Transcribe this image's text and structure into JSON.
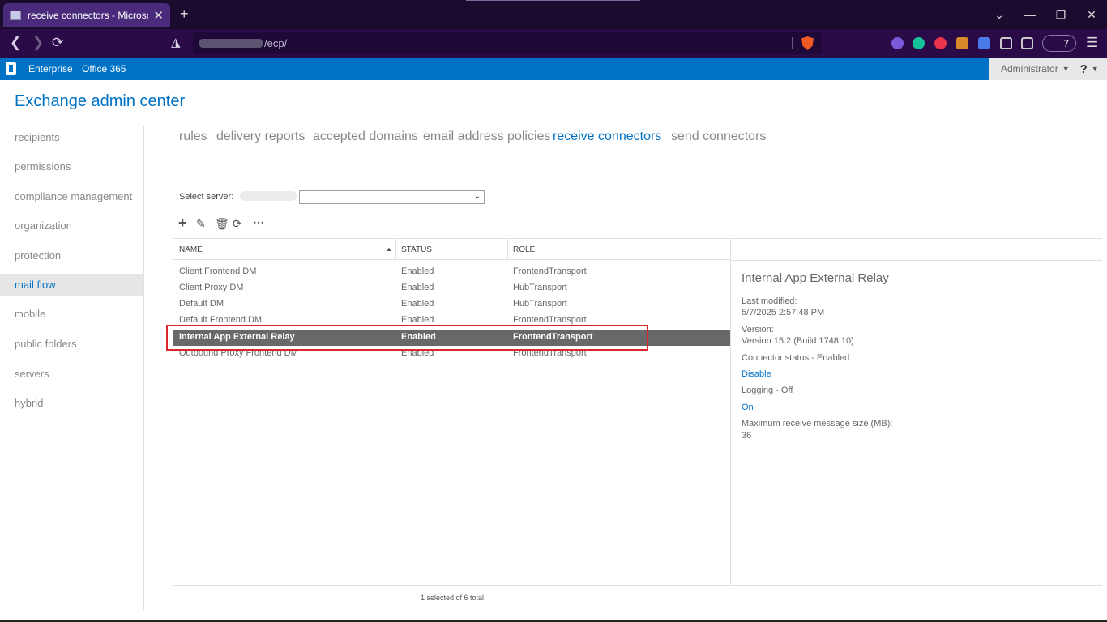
{
  "browser": {
    "tab_title": "receive connectors - Microsoft",
    "tab_close": "✕",
    "new_tab": "+",
    "url_text": "/ecp/",
    "extension_badge": "7",
    "win_minimize": "⌄",
    "win_min": "—",
    "win_restore": "❐",
    "win_close": "✕"
  },
  "ecp_header": {
    "enterprise": "Enterprise",
    "office365": "Office 365",
    "admin": "Administrator",
    "help": "?"
  },
  "app_title": "Exchange admin center",
  "left_nav": [
    {
      "label": "recipients"
    },
    {
      "label": "permissions"
    },
    {
      "label": "compliance management"
    },
    {
      "label": "organization"
    },
    {
      "label": "protection"
    },
    {
      "label": "mail flow",
      "selected": true
    },
    {
      "label": "mobile"
    },
    {
      "label": "public folders"
    },
    {
      "label": "servers"
    },
    {
      "label": "hybrid"
    }
  ],
  "sub_tabs": [
    {
      "label": "rules"
    },
    {
      "label": "delivery reports"
    },
    {
      "label": "accepted domains"
    },
    {
      "label": "email address policies"
    },
    {
      "label": "receive connectors",
      "active": true
    },
    {
      "label": "send connectors"
    }
  ],
  "server_select": {
    "label": "Select server:"
  },
  "grid": {
    "columns": [
      "NAME",
      "STATUS",
      "ROLE"
    ],
    "rows": [
      {
        "name": "Client Frontend DM",
        "status": "Enabled",
        "role": "FrontendTransport"
      },
      {
        "name": "Client Proxy DM",
        "status": "Enabled",
        "role": "HubTransport"
      },
      {
        "name": "Default DM",
        "status": "Enabled",
        "role": "HubTransport"
      },
      {
        "name": "Default Frontend DM",
        "status": "Enabled",
        "role": "FrontendTransport"
      },
      {
        "name": "Internal App External Relay",
        "status": "Enabled",
        "role": "FrontendTransport",
        "selected": true
      },
      {
        "name": "Outbound Proxy Frontend DM",
        "status": "Enabled",
        "role": "FrontendTransport"
      }
    ],
    "footer": "1 selected of 6 total"
  },
  "details": {
    "title": "Internal App External Relay",
    "last_modified_label": "Last modified:",
    "last_modified_value": "5/7/2025 2:57:48 PM",
    "version_label": "Version:",
    "version_value": "Version 15.2 (Build 1748.10)",
    "connector_status": "Connector status - Enabled",
    "disable_link": "Disable",
    "logging": "Logging - Off",
    "on_link": "On",
    "max_size_label": "Maximum receive message size (MB):",
    "max_size_value": "36"
  },
  "colors": {
    "brand_blue": "#0072c6",
    "selected_row": "#686868",
    "highlight_box": "#d9262f"
  }
}
